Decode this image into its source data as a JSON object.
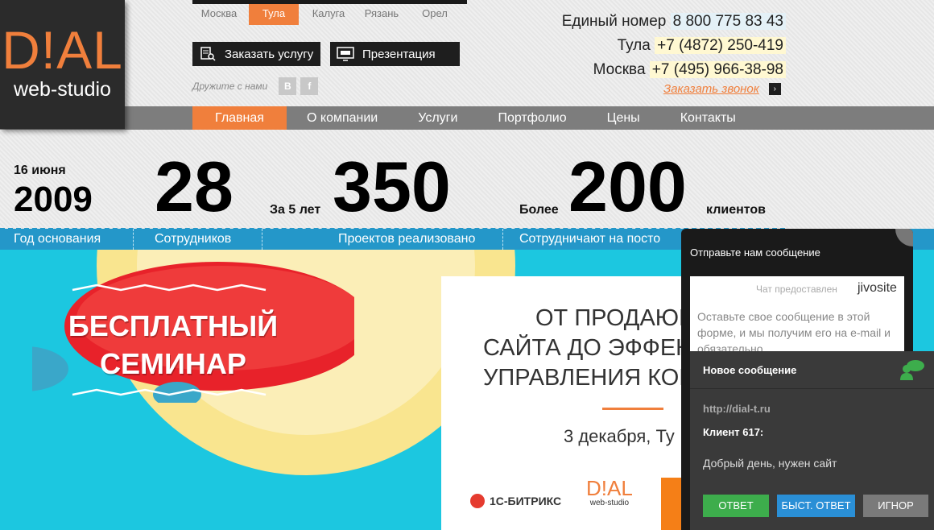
{
  "logo": {
    "mark": "D!AL",
    "sub": "web-studio"
  },
  "cities": {
    "items": [
      "Москва",
      "Тула",
      "Калуга",
      "Рязань",
      "Орел"
    ],
    "active": "Тула"
  },
  "buttons": {
    "order": "Заказать услугу",
    "presentation": "Презентация"
  },
  "social": {
    "label": "Дружите с нами",
    "vk": "В",
    "fb": "f"
  },
  "phones": [
    {
      "label": "Единый номер",
      "number": "8 800 775 83 43"
    },
    {
      "label": "Тула",
      "number": "+7 (4872) 250-419"
    },
    {
      "label": "Москва",
      "number": "+7 (495) 966-38-98"
    }
  ],
  "callback": {
    "label": "Заказать звонок",
    "arrow": "›"
  },
  "nav": {
    "items": [
      "Главная",
      "О компании",
      "Услуги",
      "Портфолио",
      "Цены",
      "Контакты"
    ],
    "active": "Главная"
  },
  "stats": {
    "founded_date": "16 июня",
    "founded_year": "2009",
    "employees": "28",
    "projects_prefix": "За 5 лет",
    "projects": "350",
    "clients_prefix": "Более",
    "clients": "200",
    "clients_suffix": "клиентов",
    "labels": [
      "Год основания",
      "Сотрудников",
      "Проектов реализовано",
      "Сотрудничают на посто"
    ]
  },
  "banner": {
    "zeppelin_line1": "БЕСПЛАТНЫЙ",
    "zeppelin_line2": "СЕМИНАР",
    "card_line1": "ОТ ПРОДАЮЩ",
    "card_line2": "САЙТА ДО ЭФФЕК",
    "card_line3": "УПРАВЛЕНИЯ КОМ",
    "card_date": "3 декабря, Ту",
    "partner_bitrix": "1С-БИТРИКС",
    "partner_dial_mark": "D!AL",
    "partner_dial_sub": "web-studio"
  },
  "chat": {
    "title": "Отправьте нам сообщение",
    "provided_by": "Чат предоставлен",
    "brand": "jivosite",
    "message": "Оставьте свое сообщение в этой форме, и мы получим его на e-mail и обязательно"
  },
  "notification": {
    "title": "Новое сообщение",
    "url": "http://dial-t.ru",
    "client": "Клиент 617:",
    "text": "Добрый день, нужен сайт",
    "reply": "ОТВЕТ",
    "quick_reply": "БЫСТ. ОТВЕТ",
    "ignore": "ИГНОР"
  },
  "colors": {
    "brand_orange": "#f07f3c",
    "stats_blue": "#2497c9",
    "banner_cyan": "#1cc7e0"
  }
}
